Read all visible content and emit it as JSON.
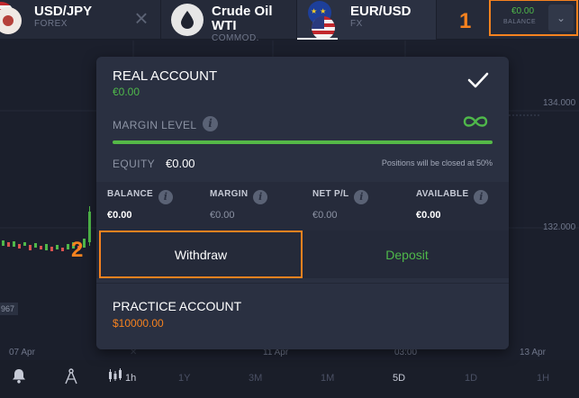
{
  "tabs": [
    {
      "title": "USD/JPY",
      "subtitle": "FOREX"
    },
    {
      "title": "Crude Oil WTI",
      "subtitle": "COMMOD."
    },
    {
      "title": "EUR/USD",
      "subtitle": "FX"
    }
  ],
  "balance_widget": {
    "value": "€0.00",
    "label": "BALANCE"
  },
  "steps": {
    "one": "1",
    "two": "2"
  },
  "chart": {
    "prices": [
      "134.000",
      "132.000"
    ],
    "times": [
      "07 Apr",
      "11 Apr",
      "03:00",
      "13 Apr"
    ],
    "side_label": "967"
  },
  "real_account": {
    "title": "REAL ACCOUNT",
    "amount": "€0.00",
    "margin_label": "MARGIN LEVEL",
    "equity_label": "EQUITY",
    "equity_value": "€0.00",
    "close_note": "Positions will be closed at 50%",
    "stats": [
      {
        "label": "BALANCE",
        "value": "€0.00"
      },
      {
        "label": "MARGIN",
        "value": "€0.00"
      },
      {
        "label": "NET P/L",
        "value": "€0.00"
      },
      {
        "label": "AVAILABLE",
        "value": "€0.00"
      }
    ],
    "withdraw_label": "Withdraw",
    "deposit_label": "Deposit"
  },
  "practice_account": {
    "title": "PRACTICE ACCOUNT",
    "amount": "$10000.00"
  },
  "bottom_toolbar": {
    "candle_interval": "1h",
    "timeframes": [
      "1Y",
      "3M",
      "1M",
      "5D",
      "1D",
      "1H"
    ],
    "active_timeframe": "5D"
  },
  "colors": {
    "accent": "#f6821f",
    "positive": "#4fb84a",
    "panel": "#2a3041"
  }
}
